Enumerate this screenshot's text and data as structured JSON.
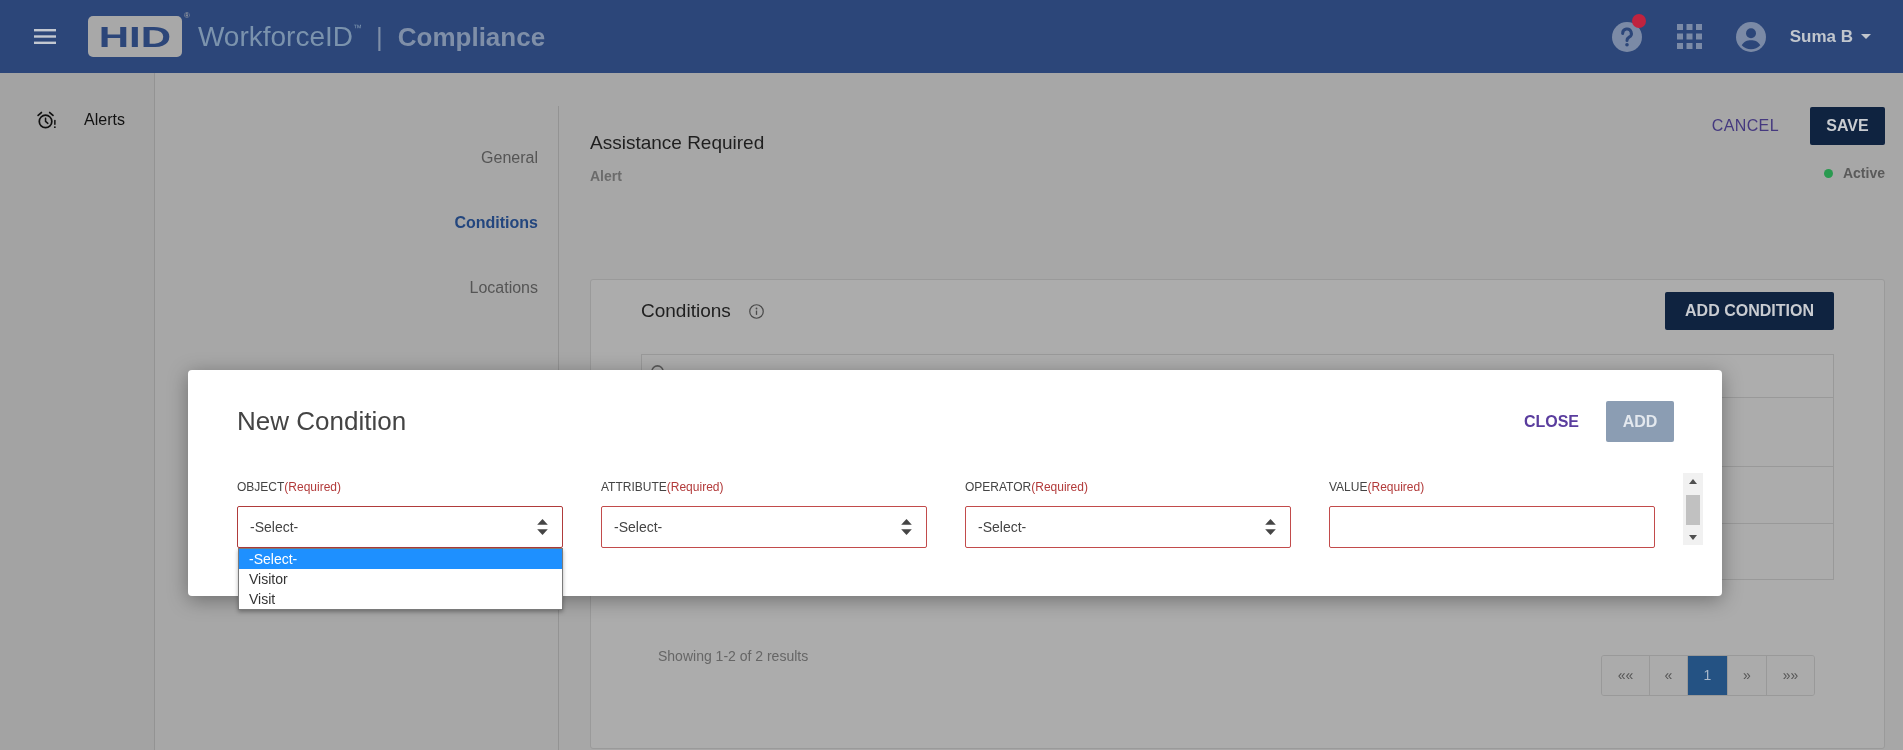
{
  "header": {
    "logo": {
      "mark": "HID",
      "registered": "®"
    },
    "product": "WorkforceID$^{™}$",
    "separator": "|",
    "module": "Compliance",
    "help": {
      "notification": true
    },
    "user": "Suma B"
  },
  "sidebar": {
    "items": [
      {
        "label": "Alerts"
      }
    ]
  },
  "section_nav": [
    {
      "label": "General",
      "selected": false
    },
    {
      "label": "Conditions",
      "selected": true
    },
    {
      "label": "Locations",
      "selected": false
    }
  ],
  "alert": {
    "title": "Assistance Required",
    "subtitle": "Alert",
    "status": {
      "label": "Active",
      "active": true
    }
  },
  "actions": {
    "cancel": "CANCEL",
    "save": "SAVE"
  },
  "conditions_card": {
    "title": "Conditions",
    "add_button": "ADD CONDITION",
    "results": "Showing 1-2 of 2 results",
    "pagination": [
      {
        "label": "««",
        "selected": false
      },
      {
        "label": "«",
        "selected": false
      },
      {
        "label": "1",
        "selected": true
      },
      {
        "label": "»",
        "selected": false
      },
      {
        "label": "»»",
        "selected": false
      }
    ]
  },
  "modal": {
    "title": "New Condition",
    "close": "CLOSE",
    "add": {
      "label": "ADD",
      "disabled": true
    },
    "fields": [
      {
        "label": "OBJECT",
        "note": "(Required)",
        "kind": "select",
        "value": "-Select-",
        "open": true,
        "options": [
          {
            "label": "-Select-",
            "selected": true
          },
          {
            "label": "Visitor",
            "selected": false
          },
          {
            "label": "Visit",
            "selected": false
          }
        ]
      },
      {
        "label": "ATTRIBUTE",
        "note": "(Required)",
        "kind": "select",
        "value": "-Select-",
        "open": false
      },
      {
        "label": "OPERATOR",
        "note": "(Required)",
        "kind": "select",
        "value": "-Select-",
        "open": false
      },
      {
        "label": "VALUE",
        "note": "(Required)",
        "kind": "text"
      }
    ]
  }
}
